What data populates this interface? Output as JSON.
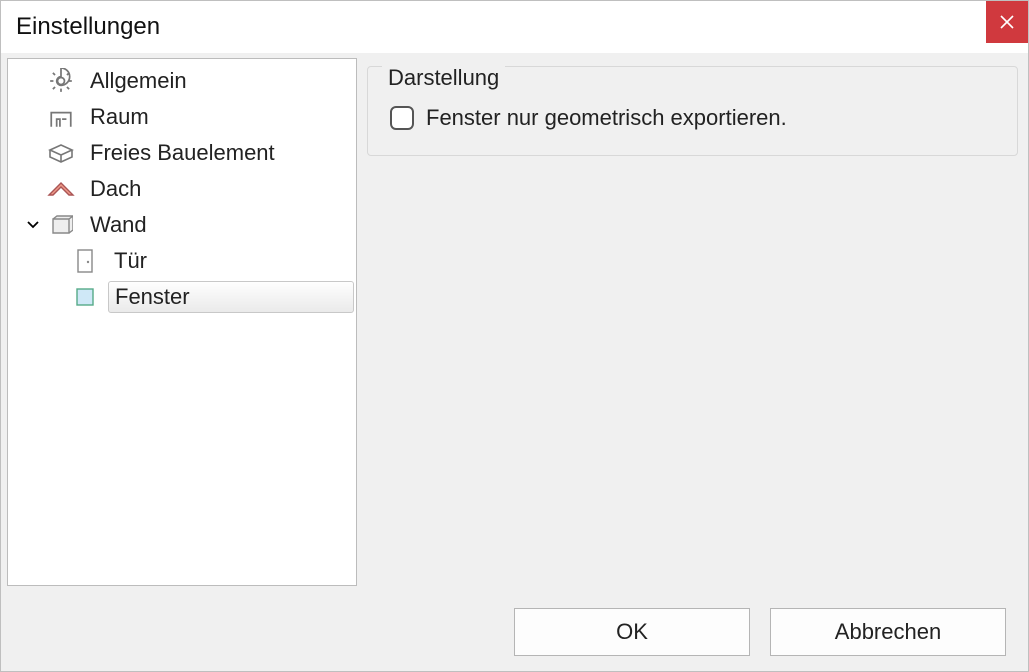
{
  "window": {
    "title": "Einstellungen"
  },
  "tree": {
    "items": [
      {
        "label": "Allgemein",
        "icon": "gear"
      },
      {
        "label": "Raum",
        "icon": "room"
      },
      {
        "label": "Freies Bauelement",
        "icon": "box"
      },
      {
        "label": "Dach",
        "icon": "roof"
      },
      {
        "label": "Wand",
        "icon": "wall",
        "expanded": true
      }
    ],
    "children": [
      {
        "label": "Tür",
        "icon": "door"
      },
      {
        "label": "Fenster",
        "icon": "window",
        "selected": true
      }
    ]
  },
  "panel": {
    "group_title": "Darstellung",
    "checkbox_label": "Fenster nur geometrisch exportieren.",
    "checkbox_checked": false
  },
  "buttons": {
    "ok": "OK",
    "cancel": "Abbrechen"
  }
}
